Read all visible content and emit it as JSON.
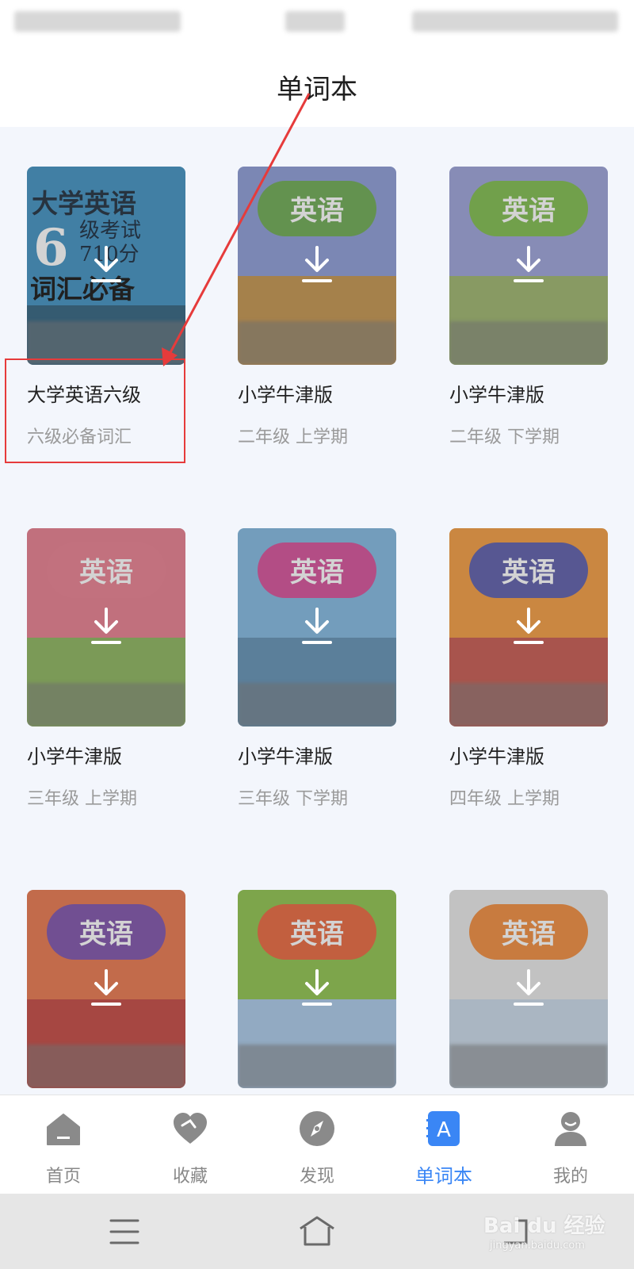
{
  "page": {
    "title": "单词本"
  },
  "books": [
    {
      "name": "大学英语六级",
      "subtitle": "六级必备词汇",
      "cover_title": "大学英语",
      "cover_number": "6",
      "cover_sub1": "级考试",
      "cover_sub2": "710分",
      "cover_vocab": "词汇必备",
      "cover_color": "#3d8fc0"
    },
    {
      "name": "小学牛津版",
      "subtitle": "二年级 上学期",
      "cover_title": "英语",
      "cloud_color": "#6aa84f",
      "sky_color": "#8a9ad6",
      "ground_color": "#c2924a"
    },
    {
      "name": "小学牛津版",
      "subtitle": "二年级 下学期",
      "cover_title": "英语",
      "cloud_color": "#7dbb4a",
      "sky_color": "#9aa0d8",
      "ground_color": "#9bb36a"
    },
    {
      "name": "小学牛津版",
      "subtitle": "三年级 上学期",
      "cover_title": "英语",
      "cloud_color": "#e87d8e",
      "sky_color": "#e77b8c",
      "ground_color": "#8ab35a"
    },
    {
      "name": "小学牛津版",
      "subtitle": "三年级 下学期",
      "cover_title": "英语",
      "cloud_color": "#d44d97",
      "sky_color": "#7fb7e0",
      "ground_color": "#5f8fb3"
    },
    {
      "name": "小学牛津版",
      "subtitle": "四年级 上学期",
      "cover_title": "英语",
      "cloud_color": "#5a5aa8",
      "sky_color": "#f39a3c",
      "ground_color": "#c6564c"
    },
    {
      "name": "",
      "subtitle": "",
      "cover_title": "英语",
      "cloud_color": "#7d4fa8",
      "sky_color": "#e9754a",
      "ground_color": "#c3443e"
    },
    {
      "name": "",
      "subtitle": "",
      "cover_title": "英语",
      "cloud_color": "#e8643a",
      "sky_color": "#8cc24a",
      "ground_color": "#a8c8e8"
    },
    {
      "name": "",
      "subtitle": "",
      "cover_title": "英语",
      "cloud_color": "#f08a3a",
      "sky_color": "#e8e8e8",
      "ground_color": "#c8d8e8"
    }
  ],
  "tabs": [
    {
      "label": "首页",
      "icon": "home-icon",
      "active": false
    },
    {
      "label": "收藏",
      "icon": "heart-icon",
      "active": false
    },
    {
      "label": "发现",
      "icon": "compass-icon",
      "active": false
    },
    {
      "label": "单词本",
      "icon": "vocabulary-book-icon",
      "active": true
    },
    {
      "label": "我的",
      "icon": "profile-icon",
      "active": false
    }
  ],
  "colors": {
    "accent": "#3a86f5",
    "highlight": "#e63b3b",
    "inactive": "#888888"
  },
  "watermark": {
    "text": "Bai du 经验",
    "sub": "jingyan.baidu.com"
  }
}
